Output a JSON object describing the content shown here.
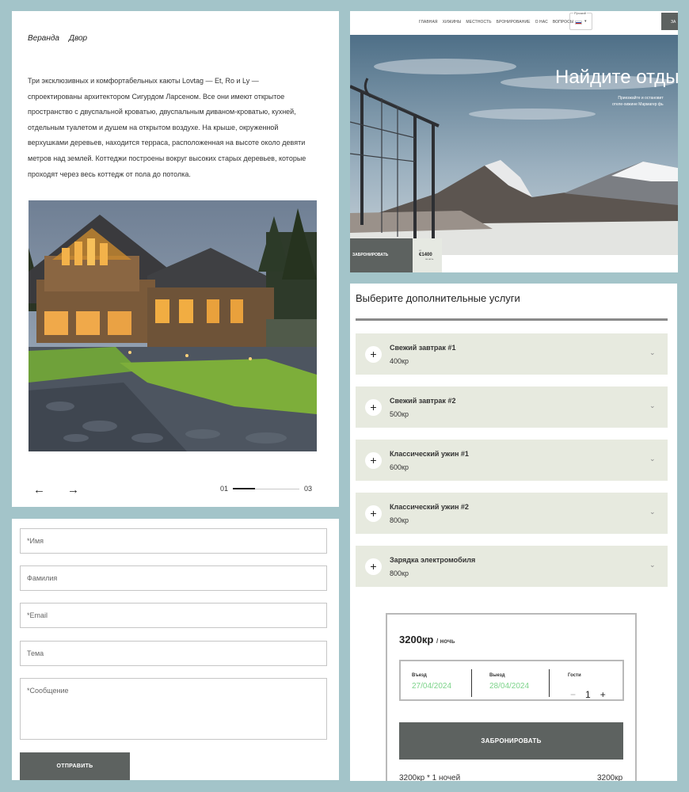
{
  "gallery": {
    "tabs": [
      "Веранда",
      "Двор"
    ],
    "description": "Три эксклюзивных и комфортабельных каюты Lovtag — Et, Ro и Ly — спроектированы архитектором Сигурдом Ларсеном. Все они имеют открытое пространство с двуспальной кроватью, двуспальным диваном-кроватью, кухней, отдельным туалетом и душем на открытом воздухе. На крыше, окруженной верхушками деревьев, находится терраса, расположенная на высоте около девяти метров над землей. Коттеджи построены вокруг высоких старых деревьев, которые проходят через весь коттедж от пола до потолка.",
    "prev_icon": "←",
    "next_icon": "→",
    "page_current": "01",
    "page_total": "03",
    "progress": 0.33
  },
  "form": {
    "first_name_placeholder": "*Имя",
    "last_name_placeholder": "Фамилия",
    "email_placeholder": "*Email",
    "subject_placeholder": "Тема",
    "message_placeholder": "*Сообщение",
    "submit_label": "ОТПРАВИТЬ"
  },
  "hero": {
    "nav_links": [
      "ГЛАВНАЯ",
      "ХИЖИНЫ",
      "МЕСТНОСТЬ",
      "БРОНИРОВАНИЕ",
      "О НАС",
      "ВОПРОСЫ"
    ],
    "lang_label": "Ру́сский",
    "lang_caret": "▾",
    "nav_cta": "ЗА",
    "title": "Найдите отдых в",
    "subtitle_line1": "Приезжайте и остановит",
    "subtitle_line2": "отеле-хижине Мармагер фь",
    "book_label": "ЗАБРОНИРОВАТЬ",
    "price_from": "от",
    "price_value": "€1400",
    "price_per": "за ночь"
  },
  "services": {
    "title": "Выберите дополнительные услуги",
    "plus_icon": "+",
    "chevron_icon": "⌄",
    "items": [
      {
        "name": "Свежий завтрак #1",
        "price": "400кр"
      },
      {
        "name": "Свежий завтрак #2",
        "price": "500кр"
      },
      {
        "name": "Классический ужин #1",
        "price": "600кр"
      },
      {
        "name": "Классический ужин #2",
        "price": "800кр"
      },
      {
        "name": "Зарядка электромобиля",
        "price": "800кр"
      }
    ]
  },
  "booking": {
    "price": "3200кр",
    "per_night": "/ ночь",
    "checkin_label": "Въезд",
    "checkin_value": "27/04/2024",
    "checkout_label": "Выезд",
    "checkout_value": "28/04/2024",
    "guests_label": "Гости",
    "guests_value": "1",
    "minus_icon": "−",
    "plus_icon": "+",
    "book_label": "ЗАБРОНИРОВАТЬ",
    "summary_left": "3200кр * 1 ночей",
    "summary_right": "3200кр"
  },
  "colors": {
    "background": "#a3c4c9",
    "button_dark": "#5d6260",
    "service_bg": "#e7eadf",
    "date_green": "#7cd38a"
  }
}
